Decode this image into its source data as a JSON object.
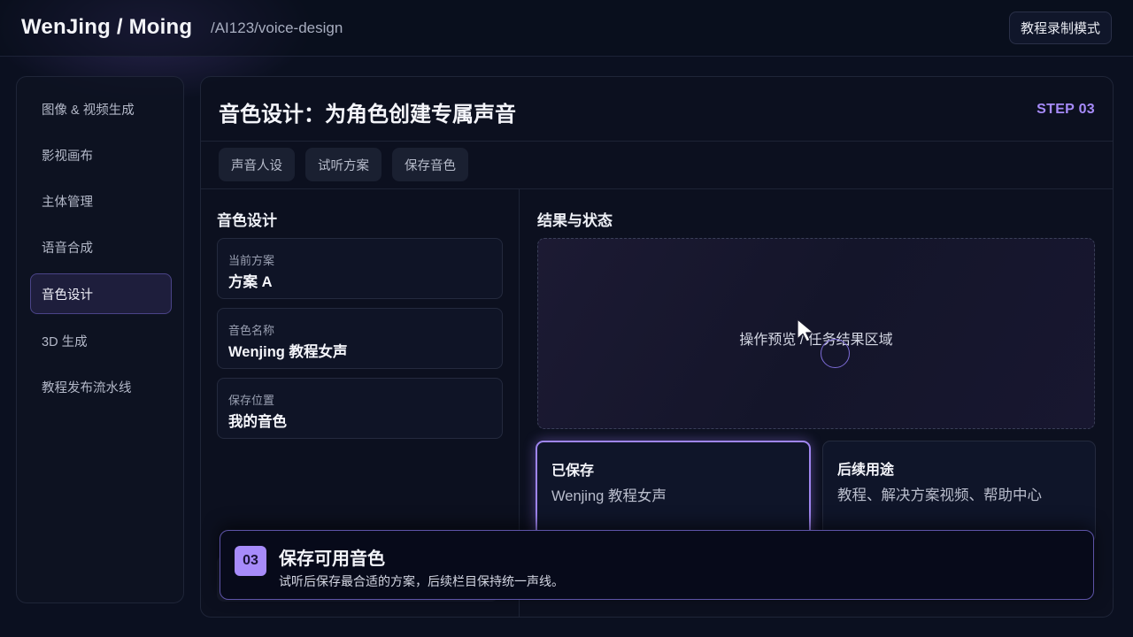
{
  "header": {
    "brand": "WenJing / Moing",
    "path": "/AI123/voice-design",
    "mode_button": "教程录制模式"
  },
  "sidebar": {
    "items": [
      {
        "label": "图像 & 视频生成",
        "active": false
      },
      {
        "label": "影视画布",
        "active": false
      },
      {
        "label": "主体管理",
        "active": false
      },
      {
        "label": "语音合成",
        "active": false
      },
      {
        "label": "音色设计",
        "active": true
      },
      {
        "label": "3D 生成",
        "active": false
      },
      {
        "label": "教程发布流水线",
        "active": false
      }
    ]
  },
  "main": {
    "title": "音色设计：为角色创建专属声音",
    "step": "STEP 03",
    "tabs": [
      {
        "label": "声音人设"
      },
      {
        "label": "试听方案"
      },
      {
        "label": "保存音色"
      }
    ],
    "design": {
      "title": "音色设计",
      "fields": [
        {
          "label": "当前方案",
          "value": "方案 A"
        },
        {
          "label": "音色名称",
          "value": "Wenjing 教程女声"
        },
        {
          "label": "保存位置",
          "value": "我的音色"
        }
      ]
    },
    "results": {
      "title": "结果与状态",
      "preview_text": "操作预览 / 任务结果区域",
      "saved": {
        "title": "已保存",
        "value": "Wenjing 教程女声"
      },
      "usage": {
        "title": "后续用途",
        "value": "教程、解决方案视频、帮助中心"
      }
    }
  },
  "banner": {
    "step_number": "03",
    "title": "保存可用音色",
    "description": "试听后保存最合适的方案，后续栏目保持统一声线。"
  },
  "colors": {
    "background": "#0b1020",
    "accent": "#a78bfa",
    "active_border": "#4a4488"
  },
  "icons": {
    "pointer": "mouse-cursor-icon"
  }
}
